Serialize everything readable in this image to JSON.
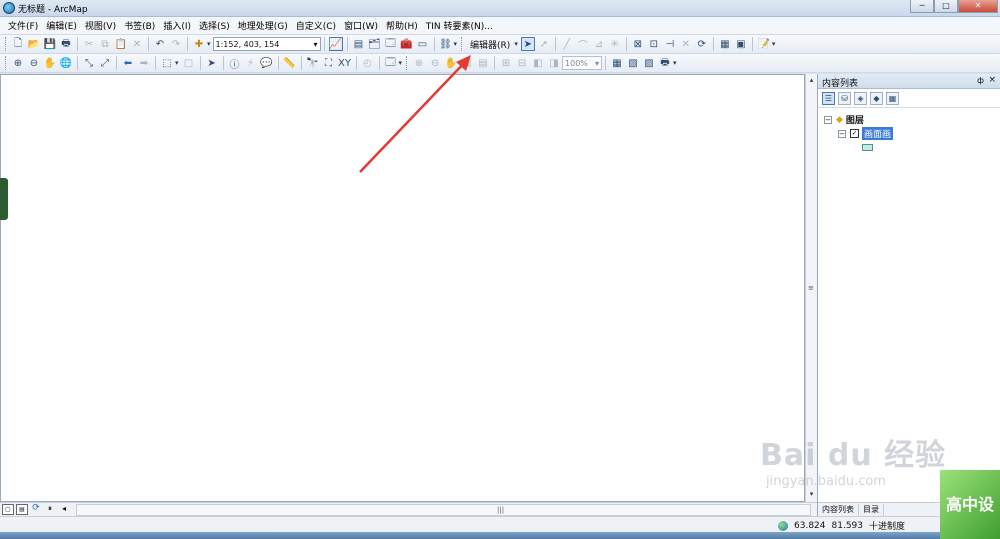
{
  "window": {
    "title": "无标题 - ArcMap",
    "minimize": "─",
    "maximize": "□",
    "close": "✕"
  },
  "menu": [
    "文件(F)",
    "编辑(E)",
    "视图(V)",
    "书签(B)",
    "插入(I)",
    "选择(S)",
    "地理处理(G)",
    "自定义(C)",
    "窗口(W)",
    "帮助(H)",
    "TIN 转要素(N)..."
  ],
  "toolbar": {
    "scale_value": "1:152, 403, 154",
    "editor_label": "编辑器(R)",
    "zoom_value": "100%"
  },
  "toc": {
    "title": "内容列表",
    "pin": "ф",
    "close": "×",
    "root_label": "图层",
    "layer_label": "画面画",
    "tabs": [
      "内容列表",
      "目录"
    ]
  },
  "status": {
    "x": "63.824",
    "y": "81.593",
    "units": "十进制度"
  },
  "watermark": {
    "brand": "Bai du 经验",
    "url": "jingyan.baidu.com",
    "badge": "高中设"
  },
  "annotation_color": "#e23b32",
  "icons": [
    "new-icon",
    "open-icon",
    "save-icon",
    "print-icon",
    "cut-icon",
    "copy-icon",
    "paste-icon",
    "delete-icon",
    "undo-icon",
    "redo-icon",
    "add-data-icon",
    "zoom-in-icon",
    "zoom-out-icon",
    "pan-icon",
    "full-extent-icon",
    "select-icon",
    "identify-icon",
    "find-icon",
    "globe-icon"
  ]
}
